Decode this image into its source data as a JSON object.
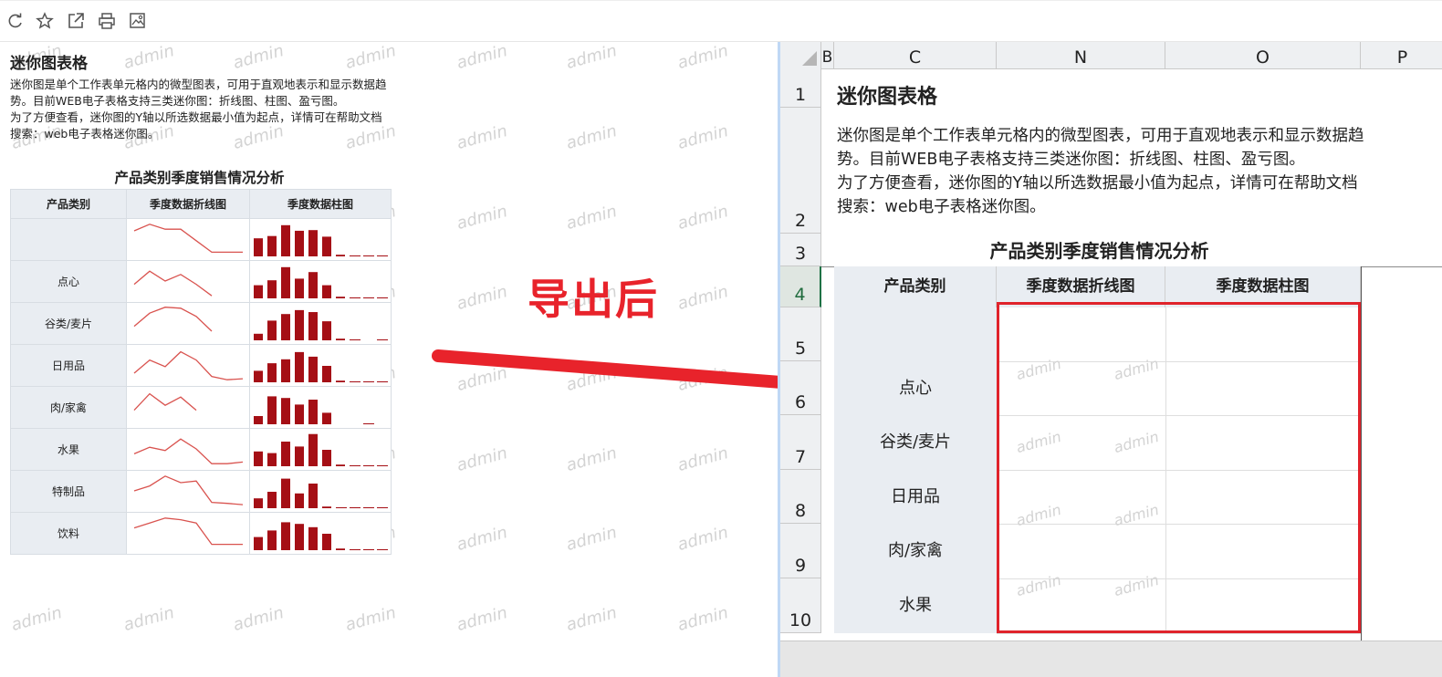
{
  "toolbar": {
    "icons": [
      "refresh-icon",
      "star-icon",
      "external-link-icon",
      "print-icon",
      "image-settings-icon"
    ]
  },
  "watermark": "admin",
  "left": {
    "title": "迷你图表格",
    "desc": [
      "迷你图是单个工作表单元格内的微型图表，可用于直观地表示和显示数据趋势。目前WEB电子表格支持三类迷你图：折线图、柱图、盈亏图。",
      "为了方便查看，迷你图的Y轴以所选数据最小值为起点，详情可在帮助文档搜索：web电子表格迷你图。"
    ],
    "chart_title": "产品类别季度销售情况分析",
    "headers": [
      "产品类别",
      "季度数据折线图",
      "季度数据柱图"
    ],
    "rows": [
      {
        "category": "",
        "line": [
          0.25,
          0.05,
          0.2,
          0.2,
          0.55,
          0.9,
          0.9,
          0.9
        ],
        "bars": [
          0.55,
          0.62,
          0.95,
          0.78,
          0.8,
          0.6,
          0.05,
          0.0,
          0.0,
          0.0
        ]
      },
      {
        "category": "点心",
        "line": [
          0.6,
          0.2,
          0.5,
          0.3,
          0.6,
          0.95,
          null,
          null
        ],
        "bars": [
          0.4,
          0.55,
          0.95,
          0.6,
          0.8,
          0.4,
          0.05,
          0.0,
          0.0,
          0.0
        ]
      },
      {
        "category": "谷类/麦片",
        "line": [
          0.6,
          0.2,
          0.02,
          0.05,
          0.3,
          0.75,
          null,
          null
        ],
        "bars": [
          0.2,
          0.6,
          0.8,
          0.92,
          0.86,
          0.58,
          0.05,
          0.0,
          null,
          0.0
        ]
      },
      {
        "category": "日用品",
        "line": [
          0.75,
          0.35,
          0.55,
          0.1,
          0.35,
          0.85,
          0.95,
          0.92
        ],
        "bars": [
          0.35,
          0.58,
          0.7,
          0.92,
          0.78,
          0.5,
          0.05,
          0.0,
          0.0,
          0.0
        ]
      },
      {
        "category": "肉/家禽",
        "line": [
          0.6,
          0.1,
          0.45,
          0.2,
          0.6,
          null,
          null,
          null
        ],
        "bars": [
          0.25,
          0.85,
          0.8,
          0.6,
          0.75,
          0.35,
          null,
          null,
          0.0,
          null
        ]
      },
      {
        "category": "水果",
        "line": [
          0.65,
          0.45,
          0.55,
          0.2,
          0.5,
          0.95,
          0.95,
          0.9
        ],
        "bars": [
          0.45,
          0.4,
          0.75,
          0.6,
          0.98,
          0.5,
          0.05,
          0.0,
          0.0,
          0.0
        ]
      },
      {
        "category": "特制品",
        "line": [
          0.5,
          0.35,
          0.05,
          0.25,
          0.2,
          0.85,
          0.88,
          0.92
        ],
        "bars": [
          0.3,
          0.5,
          0.9,
          0.45,
          0.75,
          0.05,
          0.0,
          0.0,
          0.0,
          0.0
        ]
      },
      {
        "category": "饮料",
        "line": [
          0.35,
          0.2,
          0.05,
          0.1,
          0.2,
          0.85,
          0.85,
          0.85
        ],
        "bars": [
          0.4,
          0.6,
          0.85,
          0.8,
          0.7,
          0.5,
          0.05,
          0.0,
          0.0,
          0.0
        ]
      }
    ],
    "bar_color": "#a50f15",
    "line_color": "#d9534f"
  },
  "arrow_label": "导出后",
  "excel": {
    "columns": [
      "B",
      "C",
      "N",
      "O",
      "P"
    ],
    "rows": [
      "1",
      "2",
      "3",
      "4",
      "5",
      "6",
      "7",
      "8",
      "9",
      "10"
    ],
    "title": "迷你图表格",
    "desc": [
      "迷你图是单个工作表单元格内的微型图表，可用于直观地表示和显示数据趋势。目前WEB电子表格支持三类迷你图：折线图、柱图、盈亏图。",
      "为了方便查看，迷你图的Y轴以所选数据最小值为起点，详情可在帮助文档搜索：web电子表格迷你图。"
    ],
    "chart_title": "产品类别季度销售情况分析",
    "headers": [
      "产品类别",
      "季度数据折线图",
      "季度数据柱图"
    ],
    "categories": [
      "",
      "点心",
      "谷类/麦片",
      "日用品",
      "肉/家禽",
      "水果"
    ],
    "highlight_color": "#e0232b"
  }
}
